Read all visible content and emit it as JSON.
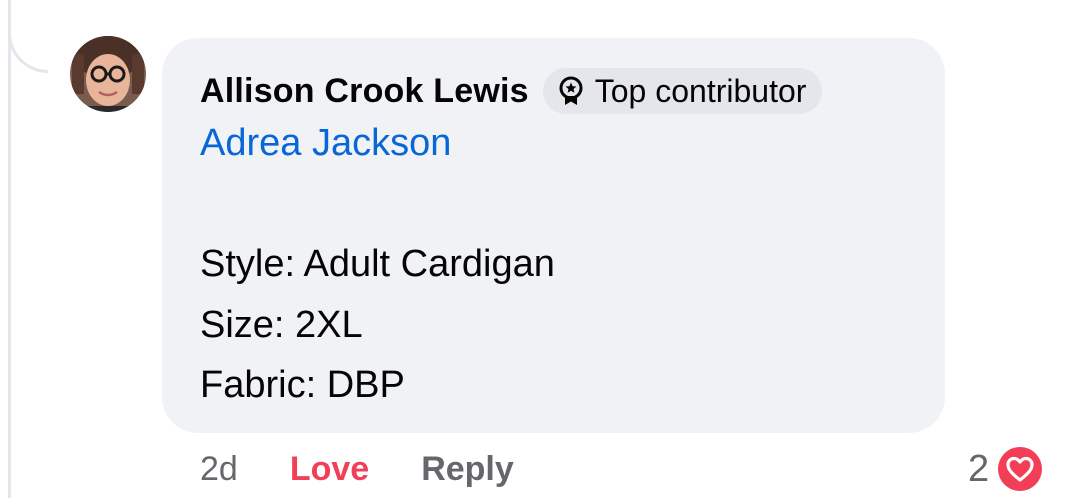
{
  "comment": {
    "author": "Allison Crook Lewis",
    "badge_label": "Top contributor",
    "badge_icon": "badge-ribbon-icon",
    "mention": "Adrea Jackson",
    "lines": [
      "Style: Adult Cardigan",
      "Size: 2XL",
      "Fabric: DBP"
    ]
  },
  "actions": {
    "time": "2d",
    "love_label": "Love",
    "reply_label": "Reply"
  },
  "reactions": {
    "count": "2",
    "icon": "love-heart-icon"
  },
  "colors": {
    "bubble_bg": "#f0f2f5",
    "mention_blue": "#0866d8",
    "love_red": "#f33e58",
    "muted_text": "#65676b"
  }
}
